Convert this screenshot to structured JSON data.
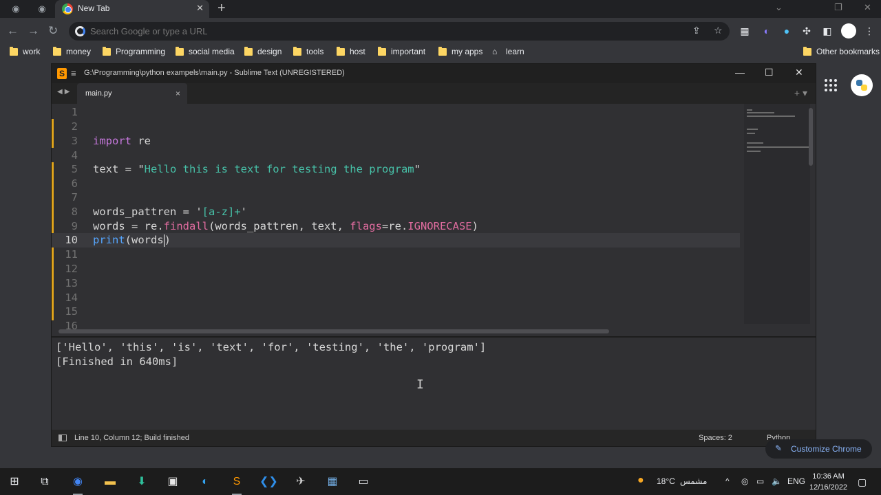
{
  "browser": {
    "tab_title": "New Tab",
    "omnibox_placeholder": "Search Google or type a URL",
    "bookmarks": [
      "work",
      "money",
      "Programming",
      "social media",
      "design",
      "tools",
      "host",
      "important",
      "my apps",
      "learn"
    ],
    "other_bookmarks": "Other bookmarks",
    "customize_label": "Customize Chrome"
  },
  "sublime": {
    "window_title": "G:\\Programming\\python exampels\\main.py - Sublime Text (UNREGISTERED)",
    "tab_name": "main.py",
    "current_line": 10,
    "line_numbers": [
      "1",
      "2",
      "3",
      "4",
      "5",
      "6",
      "7",
      "8",
      "9",
      "10",
      "11",
      "12",
      "13",
      "14",
      "15",
      "16"
    ],
    "output_lines": [
      "['Hello', 'this', 'is', 'text', 'for', 'testing', 'the', 'program']",
      "[Finished in 640ms]"
    ],
    "status_left": "Line 10, Column 12; Build finished",
    "status_spaces": "Spaces: 2",
    "status_syntax": "Python"
  },
  "code": {
    "l3_kw": "import",
    "l3_rest": " re",
    "l5_a": "text = ",
    "l5_q1": "\"",
    "l5_str": "Hello this is text for testing the program",
    "l5_q2": "\"",
    "l8_a": "words_pattren = ",
    "l8_q1": "'",
    "l8_str": "[a-z]+",
    "l8_q2": "'",
    "l9_a": "words = re.",
    "l9_fn": "findall",
    "l9_b": "(words_pattren, text, ",
    "l9_kw": "flags",
    "l9_c": "=re.",
    "l9_const": "IGNORECASE",
    "l9_d": ")",
    "l10_fn": "print",
    "l10_a": "(words",
    "l10_b": ")"
  },
  "taskbar": {
    "weather_temp": "18°C",
    "weather_text": "مشمس",
    "lang": "ENG",
    "time": "10:36 AM",
    "date": "12/16/2022"
  },
  "colors": {
    "keyword": "#c678dd",
    "string": "#47c1a8",
    "function": "#e06c9f",
    "builtin": "#56a6ff",
    "modified_marker": "#e0a41a"
  }
}
